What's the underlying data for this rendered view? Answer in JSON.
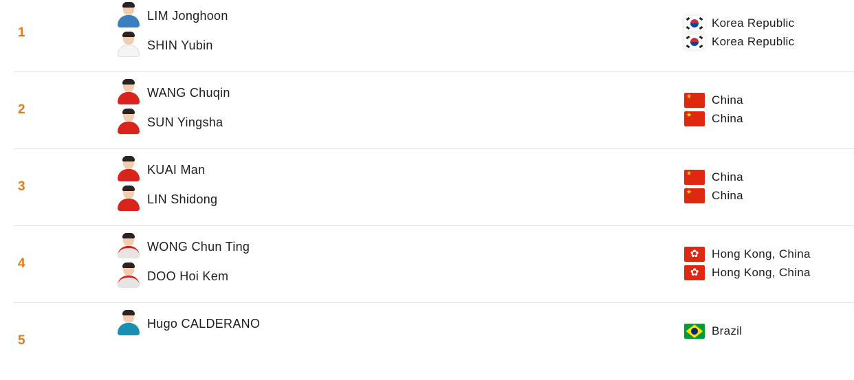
{
  "colors": {
    "rank": "#e07b1c",
    "divider": "#e2e2e2",
    "kit_korea": "#3b7fc0",
    "kit_korea_white": "#f4f4f4",
    "kit_china": "#d8241c",
    "kit_hong_kong": "#e8e4e4",
    "kit_brazil": "#1a8fb0"
  },
  "rankings": [
    {
      "rank": "1",
      "players": [
        {
          "name": "LIM Jonghoon",
          "avatar_icon": "player-photo-icon",
          "kit": "kit_korea"
        },
        {
          "name": "SHIN Yubin",
          "avatar_icon": "player-photo-icon",
          "kit": "kit_korea_white"
        }
      ],
      "nations": [
        {
          "country": "Korea Republic",
          "flag_icon": "korea-flag-icon"
        },
        {
          "country": "Korea Republic",
          "flag_icon": "korea-flag-icon"
        }
      ]
    },
    {
      "rank": "2",
      "players": [
        {
          "name": "WANG Chuqin",
          "avatar_icon": "player-photo-icon",
          "kit": "kit_china"
        },
        {
          "name": "SUN Yingsha",
          "avatar_icon": "player-photo-icon",
          "kit": "kit_china"
        }
      ],
      "nations": [
        {
          "country": "China",
          "flag_icon": "china-flag-icon"
        },
        {
          "country": "China",
          "flag_icon": "china-flag-icon"
        }
      ]
    },
    {
      "rank": "3",
      "players": [
        {
          "name": "KUAI Man",
          "avatar_icon": "player-photo-icon",
          "kit": "kit_china"
        },
        {
          "name": "LIN Shidong",
          "avatar_icon": "player-photo-icon",
          "kit": "kit_china"
        }
      ],
      "nations": [
        {
          "country": "China",
          "flag_icon": "china-flag-icon"
        },
        {
          "country": "China",
          "flag_icon": "china-flag-icon"
        }
      ]
    },
    {
      "rank": "4",
      "players": [
        {
          "name": "WONG Chun Ting",
          "avatar_icon": "player-photo-icon",
          "kit": "kit_hong_kong"
        },
        {
          "name": "DOO Hoi Kem",
          "avatar_icon": "player-photo-icon",
          "kit": "kit_hong_kong"
        }
      ],
      "nations": [
        {
          "country": "Hong Kong, China",
          "flag_icon": "hong-kong-flag-icon"
        },
        {
          "country": "Hong Kong, China",
          "flag_icon": "hong-kong-flag-icon"
        }
      ]
    },
    {
      "rank": "5",
      "players": [
        {
          "name": "Hugo CALDERANO",
          "avatar_icon": "player-photo-icon",
          "kit": "kit_brazil"
        }
      ],
      "nations": [
        {
          "country": "Brazil",
          "flag_icon": "brazil-flag-icon"
        }
      ]
    }
  ]
}
